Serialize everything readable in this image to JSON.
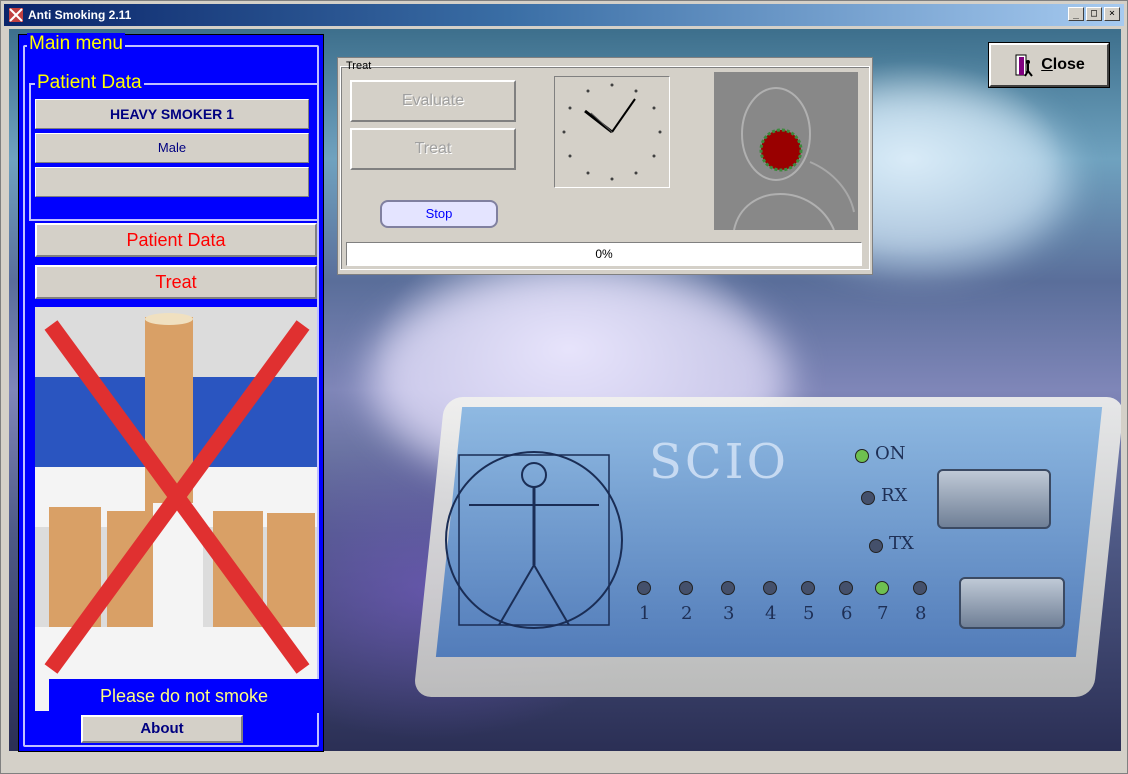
{
  "window": {
    "title": "Anti Smoking 2.11",
    "controls": [
      "_",
      "□",
      "×"
    ]
  },
  "main_menu": {
    "title": "Main menu",
    "patient_group": {
      "title": "Patient Data",
      "name": "HEAVY SMOKER 1",
      "gender": "Male",
      "extra": ""
    },
    "patient_data_button": "Patient Data",
    "treat_button": "Treat",
    "notice": "Please do not smoke",
    "about_button": "About"
  },
  "treat_panel": {
    "title": "Treat",
    "evaluate_button": "Evaluate",
    "treat_button": "Treat",
    "stop_button": "Stop",
    "progress_label": "0%",
    "progress_value": 0
  },
  "close_button": {
    "first_letter": "C",
    "rest": "lose"
  },
  "device": {
    "brand": "SCIO",
    "indicators": [
      "ON",
      "RX",
      "TX"
    ],
    "channels": [
      "1",
      "2",
      "3",
      "4",
      "5",
      "6",
      "7",
      "8"
    ]
  },
  "colors": {
    "menu_bg": "#0000ff",
    "menu_title": "#ffff00",
    "button_text_red": "#ff0000",
    "face_target": "#990000"
  }
}
